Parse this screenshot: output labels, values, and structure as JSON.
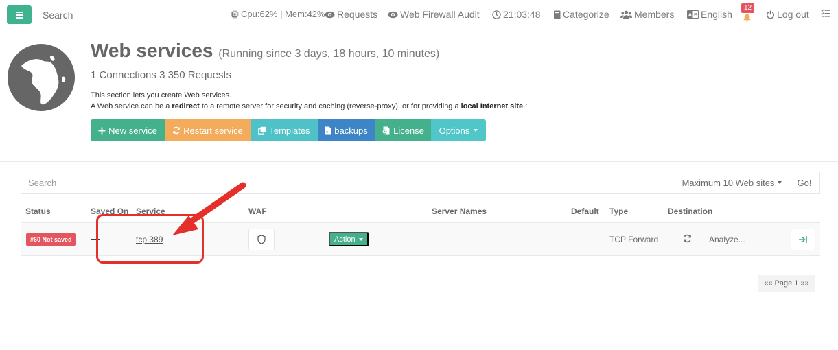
{
  "topbar": {
    "search_placeholder": "Search",
    "stats": "Cpu:62% | Mem:42%",
    "requests": "Requests",
    "waf_audit": "Web Firewall Audit",
    "time": "21:03:48",
    "categorize": "Categorize",
    "members": "Members",
    "language": "English",
    "notifications_count": "12",
    "logout": "Log out"
  },
  "header": {
    "title": "Web services",
    "subtitle": "(Running since 3 days, 18 hours, 10 minutes)",
    "connections": "1 Connections 3 350 Requests",
    "desc_line1": "This section lets you create Web services.",
    "desc_line2_a": "A Web service can be a ",
    "desc_line2_b": "redirect",
    "desc_line2_c": " to a remote server for security and caching (reverse-proxy), or for providing a ",
    "desc_line2_d": "local Internet site",
    "desc_line2_e": ".:"
  },
  "buttons": {
    "new_service": "New service",
    "restart_service": "Restart service",
    "templates": "Templates",
    "backups": "backups",
    "license": "License",
    "options": "Options"
  },
  "search": {
    "placeholder": "Search",
    "max_label": "Maximum 10 Web sites",
    "go_label": "Go!"
  },
  "table": {
    "headers": [
      "Status",
      "Saved On",
      "Service",
      "WAF",
      "Server Names",
      "Default",
      "Type",
      "Destination"
    ],
    "rows": [
      {
        "status": "#60 Not saved",
        "saved_on": "—",
        "service": "tcp 389",
        "action": "Action",
        "type": "TCP Forward",
        "destination": "Analyze..."
      }
    ]
  },
  "pager": {
    "label": "«« Page 1 »»"
  },
  "colors": {
    "primary_green": "#45b08c",
    "warning_orange": "#f2ac5b",
    "info_teal": "#4fc2c7",
    "blue": "#3d85c6",
    "danger_red": "#e4555f",
    "annotation_red": "#e4302b"
  }
}
